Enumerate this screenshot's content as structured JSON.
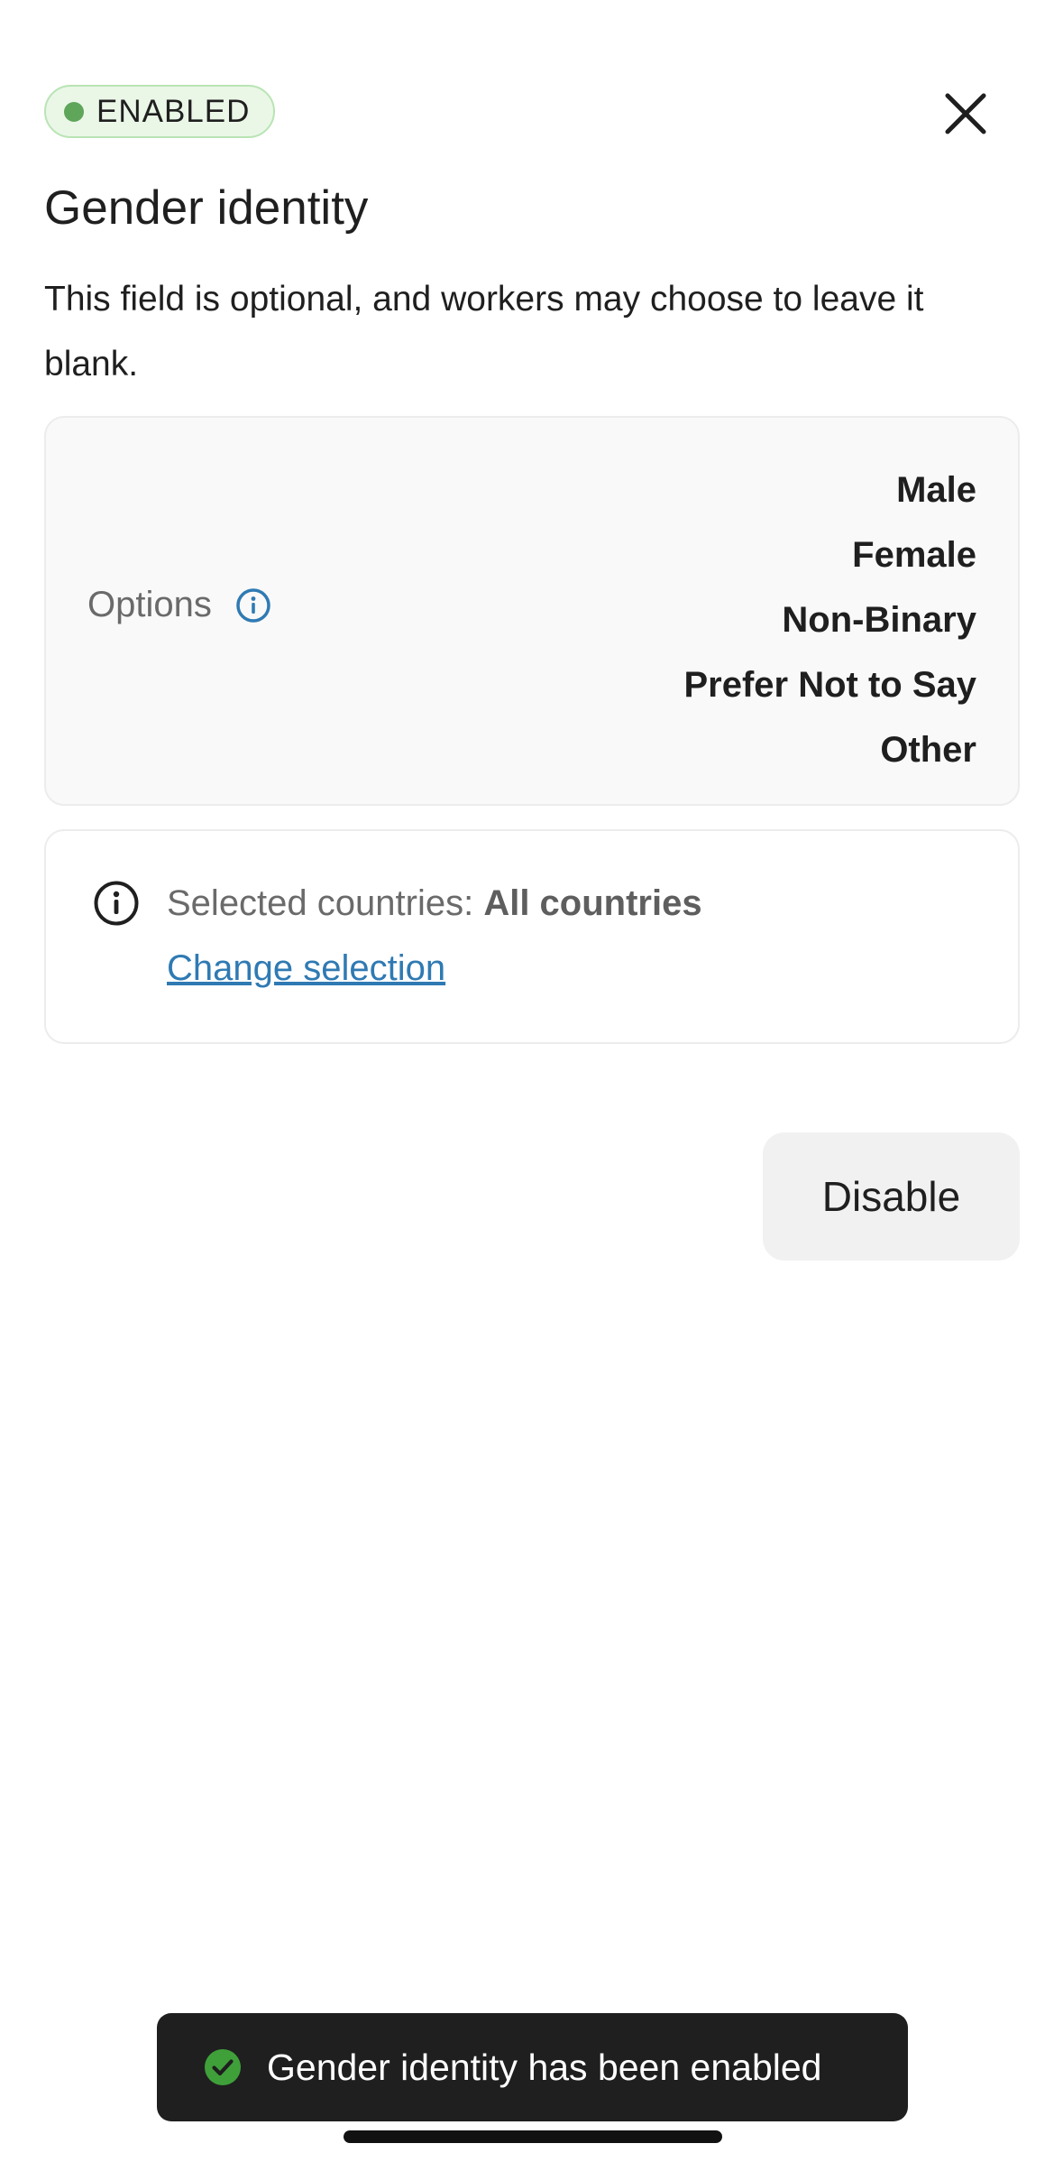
{
  "status_badge": {
    "label": "ENABLED"
  },
  "header": {
    "title": "Gender identity"
  },
  "description": "This field is optional, and workers may choose to leave it blank.",
  "options_card": {
    "label": "Options",
    "items": [
      "Male",
      "Female",
      "Non-Binary",
      "Prefer Not to Say",
      "Other"
    ]
  },
  "countries_card": {
    "label": "Selected countries: ",
    "value": "All countries",
    "change_link": "Change selection"
  },
  "actions": {
    "disable_label": "Disable"
  },
  "toast": {
    "message": "Gender identity has been enabled"
  },
  "colors": {
    "badge_bg": "#eaf7e7",
    "badge_dot": "#5fa55a",
    "link": "#2f7ab3",
    "toast_bg": "#1f1f1f",
    "toast_check": "#3fa03a"
  },
  "icons": {
    "badge": "status-dot-icon",
    "close": "close-icon",
    "options_info": "info-icon",
    "countries_info": "info-icon",
    "toast": "check-circle-icon"
  }
}
